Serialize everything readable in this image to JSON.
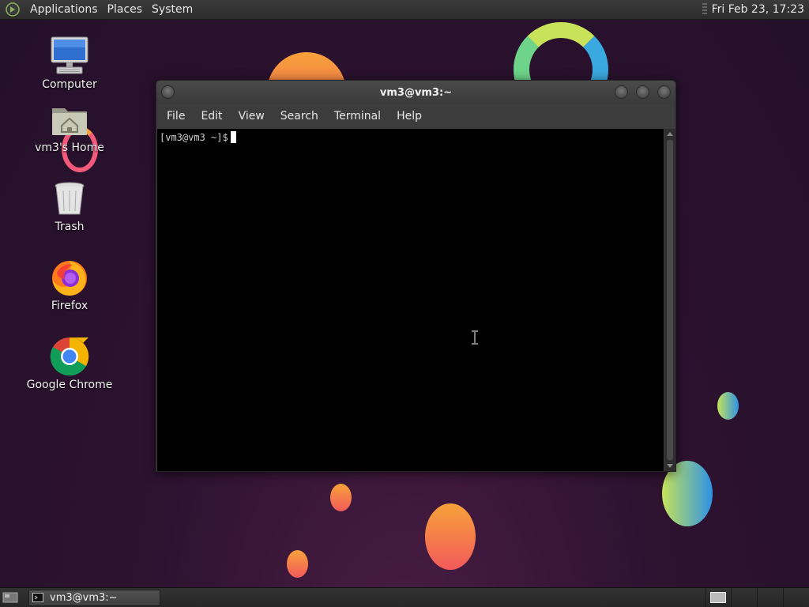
{
  "top_panel": {
    "menus": [
      "Applications",
      "Places",
      "System"
    ],
    "clock": "Fri Feb 23, 17:23"
  },
  "desktop": {
    "icons": [
      {
        "label": "Computer",
        "icon": "computer-icon"
      },
      {
        "label": "vm3's Home",
        "icon": "home-folder-icon"
      },
      {
        "label": "Trash",
        "icon": "trash-icon"
      },
      {
        "label": "Firefox",
        "icon": "firefox-icon"
      },
      {
        "label": "Google Chrome",
        "icon": "chrome-icon"
      }
    ]
  },
  "terminal": {
    "title": "vm3@vm3:~",
    "menus": [
      "File",
      "Edit",
      "View",
      "Search",
      "Terminal",
      "Help"
    ],
    "prompt": "[vm3@vm3 ~]$"
  },
  "taskbar": {
    "task_label": "vm3@vm3:~"
  },
  "colors": {
    "panel": "#2c2c2c",
    "wallpaper": "#2a1129",
    "terminal_bg": "#000000"
  }
}
